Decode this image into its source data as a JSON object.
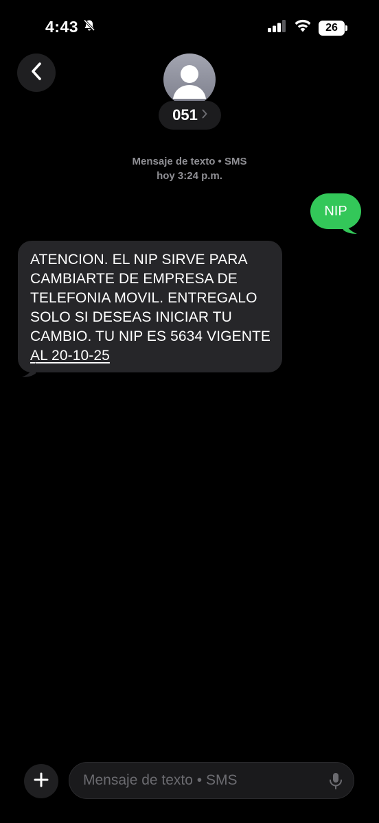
{
  "status_bar": {
    "time": "4:43",
    "battery": "26",
    "icons": [
      "bell-slash-icon",
      "signal-icon",
      "wifi-icon",
      "battery-icon"
    ]
  },
  "header": {
    "contact_name": "051",
    "back_icon": "chevron-left-icon",
    "avatar_icon": "person-icon"
  },
  "thread": {
    "service_label": "Mensaje de texto • SMS",
    "timestamp": "hoy 3:24 p.m."
  },
  "messages": {
    "outgoing": {
      "text": "NIP"
    },
    "incoming": {
      "text_main": "ATENCION. EL NIP SIRVE PARA CAMBIARTE DE EMPRESA DE TELEFONIA MOVIL. ENTREGALO SOLO SI DESEAS INICIAR TU CAMBIO. TU NIP ES 5634 VIGENTE ",
      "text_link": "AL 20-10-25"
    }
  },
  "compose": {
    "placeholder": "Mensaje de texto • SMS",
    "plus_icon": "plus-icon",
    "mic_icon": "microphone-icon"
  },
  "colors": {
    "background": "#000000",
    "outgoing_bubble": "#33c759",
    "incoming_bubble": "#262629",
    "meta_text": "#8e8e93"
  }
}
